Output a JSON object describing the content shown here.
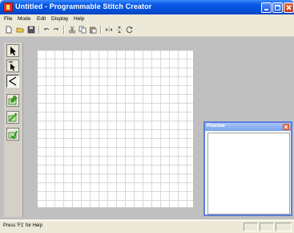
{
  "window": {
    "title": "Untitled - Programmable Stitch Creator",
    "title_color": "#ffffff",
    "titlebar_color": "#0a5ae6"
  },
  "menu": {
    "items": [
      "File",
      "Mode",
      "Edit",
      "Display",
      "Help"
    ]
  },
  "toolbar": {
    "icons": [
      "new-file-icon",
      "open-folder-icon",
      "save-icon",
      "undo-icon",
      "redo-icon",
      "cut-icon",
      "copy-icon",
      "paste-icon",
      "flip-horizontal-icon",
      "flip-vertical-icon",
      "rotate-icon"
    ]
  },
  "tools": {
    "icons": [
      "select-arrow-icon",
      "point-arrow-icon",
      "zigzag-line-icon",
      "edit-tool-1-icon",
      "edit-tool-2-icon",
      "edit-tool-3-icon"
    ]
  },
  "preview": {
    "title": "Preview"
  },
  "status": {
    "text": "Press 'F1' for Help"
  }
}
